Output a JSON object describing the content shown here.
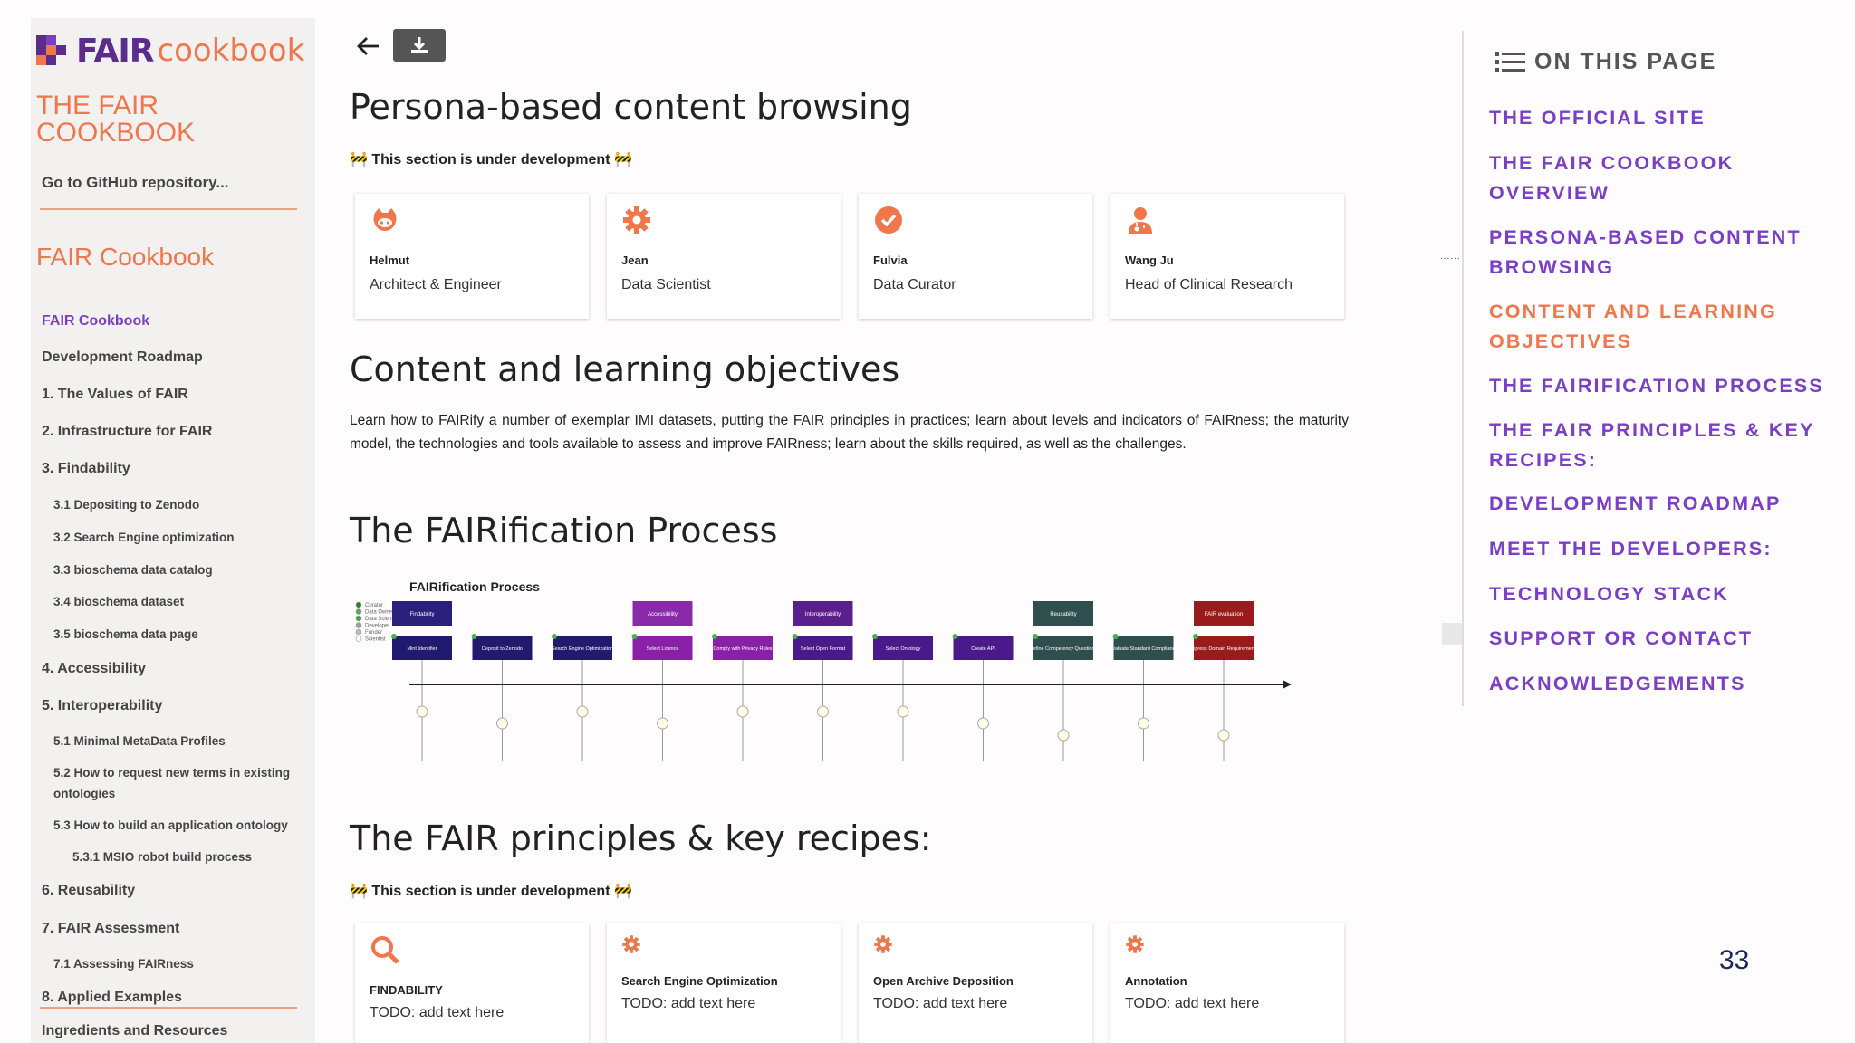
{
  "sidebar": {
    "logo_bold": "FAIR",
    "logo_light": "cookbook",
    "title": "THE FAIR COOKBOOK",
    "github_link": "Go to GitHub repository...",
    "subtitle": "FAIR Cookbook",
    "items": [
      {
        "label": "FAIR Cookbook"
      },
      {
        "label": "Development Roadmap"
      },
      {
        "label": "1. The Values of FAIR"
      },
      {
        "label": "2. Infrastructure for FAIR"
      },
      {
        "label": "3. Findability"
      },
      {
        "label": "3.1 Depositing to Zenodo"
      },
      {
        "label": "3.2 Search Engine optimization"
      },
      {
        "label": "3.3 bioschema data catalog"
      },
      {
        "label": "3.4 bioschema dataset"
      },
      {
        "label": "3.5 bioschema data page"
      },
      {
        "label": "4. Accessibility"
      },
      {
        "label": "5. Interoperability"
      },
      {
        "label": "5.1 Minimal MetaData Profiles"
      },
      {
        "label": "5.2 How to request new terms in existing ontologies"
      },
      {
        "label": "5.3 How to build an application ontology"
      },
      {
        "label": "5.3.1 MSIO robot build process"
      },
      {
        "label": "6. Reusability"
      },
      {
        "label": "7. FAIR Assessment"
      },
      {
        "label": "7.1 Assessing FAIRness"
      },
      {
        "label": "8. Applied Examples"
      },
      {
        "label": "Ingredients and Resources"
      }
    ]
  },
  "main": {
    "back_icon": "arrow-left-icon",
    "download_icon": "download-icon",
    "persona_heading": "Persona-based content browsing",
    "dev_note": "🚧 This section is under development 🚧",
    "personas": [
      {
        "name": "Helmut",
        "role": "Architect & Engineer",
        "icon": "github-icon"
      },
      {
        "name": "Jean",
        "role": "Data Scientist",
        "icon": "gear-icon"
      },
      {
        "name": "Fulvia",
        "role": "Data Curator",
        "icon": "check-circle-icon"
      },
      {
        "name": "Wang Ju",
        "role": "Head of Clinical Research",
        "icon": "doctor-icon"
      }
    ],
    "content_heading": "Content and learning objectives",
    "content_paragraph": "Learn how to FAIRify a number of exemplar IMI datasets, putting the FAIR principles in practices; learn about levels and indicators of FAIRness; the maturity model, the technologies and tools available to assess and improve FAIRness; learn about the skills required, as well as the challenges.",
    "process_heading": "The FAIRification Process",
    "process_figure": {
      "title": "FAIRification Process",
      "legend": [
        "Curator",
        "Data Owner",
        "Data Scientist",
        "Developer",
        "Funder",
        "Scientist"
      ],
      "legend_colors": [
        "#2e7d32",
        "#4caf50",
        "#43a047",
        "#9e9e9e",
        "#bdbdbd",
        "#ffffff"
      ],
      "top_steps": [
        {
          "label": "Findability",
          "color": "#2a1f7a"
        },
        {
          "label": "Accessibility",
          "color": "#8a2aa8"
        },
        {
          "label": "Interoperability",
          "color": "#5a1f8a"
        },
        {
          "label": "Reusability",
          "color": "#2f4f4f"
        },
        {
          "label": "FAIR evaluation",
          "color": "#9a1b1b"
        }
      ],
      "steps": [
        {
          "label": "Mint Identifier",
          "color": "#221a6e"
        },
        {
          "label": "Deposit to Zenodo",
          "color": "#221a6e"
        },
        {
          "label": "Search Engine Optimization",
          "color": "#221a6e"
        },
        {
          "label": "Select Licence",
          "color": "#8a1fa8"
        },
        {
          "label": "Comply with Privacy Rules",
          "color": "#8a1fa8"
        },
        {
          "label": "Select Open Format",
          "color": "#4b1a8a"
        },
        {
          "label": "Select Ontology",
          "color": "#4b1a8a"
        },
        {
          "label": "Create API",
          "color": "#4b1a8a"
        },
        {
          "label": "Define Competency Questions",
          "color": "#2f4f4f"
        },
        {
          "label": "Evaluate Standard Compliance",
          "color": "#2f4f4f"
        },
        {
          "label": "Express Domain Requirements",
          "color": "#9a1b1b"
        }
      ]
    },
    "principles_heading": "The FAIR principles & key recipes:",
    "recipes": [
      {
        "name": "FINDABILITY",
        "text": "TODO: add text here",
        "icon": "search-icon"
      },
      {
        "name": "Search Engine Optimization",
        "text": "TODO: add text here",
        "icon": "gear-icon"
      },
      {
        "name": "Open Archive Deposition",
        "text": "TODO: add text here",
        "icon": "gear-icon"
      },
      {
        "name": "Annotation",
        "text": "TODO: add text here",
        "icon": "gear-icon"
      }
    ]
  },
  "toc": {
    "heading": "ON THIS PAGE",
    "items": [
      {
        "label": "THE OFFICIAL SITE"
      },
      {
        "label": "THE FAIR COOKBOOK OVERVIEW"
      },
      {
        "label": "PERSONA-BASED CONTENT BROWSING"
      },
      {
        "label": "CONTENT AND LEARNING OBJECTIVES"
      },
      {
        "label": "THE FAIRIFICATION PROCESS"
      },
      {
        "label": "THE FAIR PRINCIPLES & KEY RECIPES:"
      },
      {
        "label": "DEVELOPMENT ROADMAP"
      },
      {
        "label": "MEET THE DEVELOPERS:"
      },
      {
        "label": "TECHNOLOGY STACK"
      },
      {
        "label": "SUPPORT OR CONTACT"
      },
      {
        "label": "ACKNOWLEDGEMENTS"
      }
    ]
  },
  "page_number": "33",
  "colors": {
    "accent_purple": "#7a3fc6",
    "accent_orange": "#f0764b",
    "brand_purple": "#5b2c8c"
  }
}
